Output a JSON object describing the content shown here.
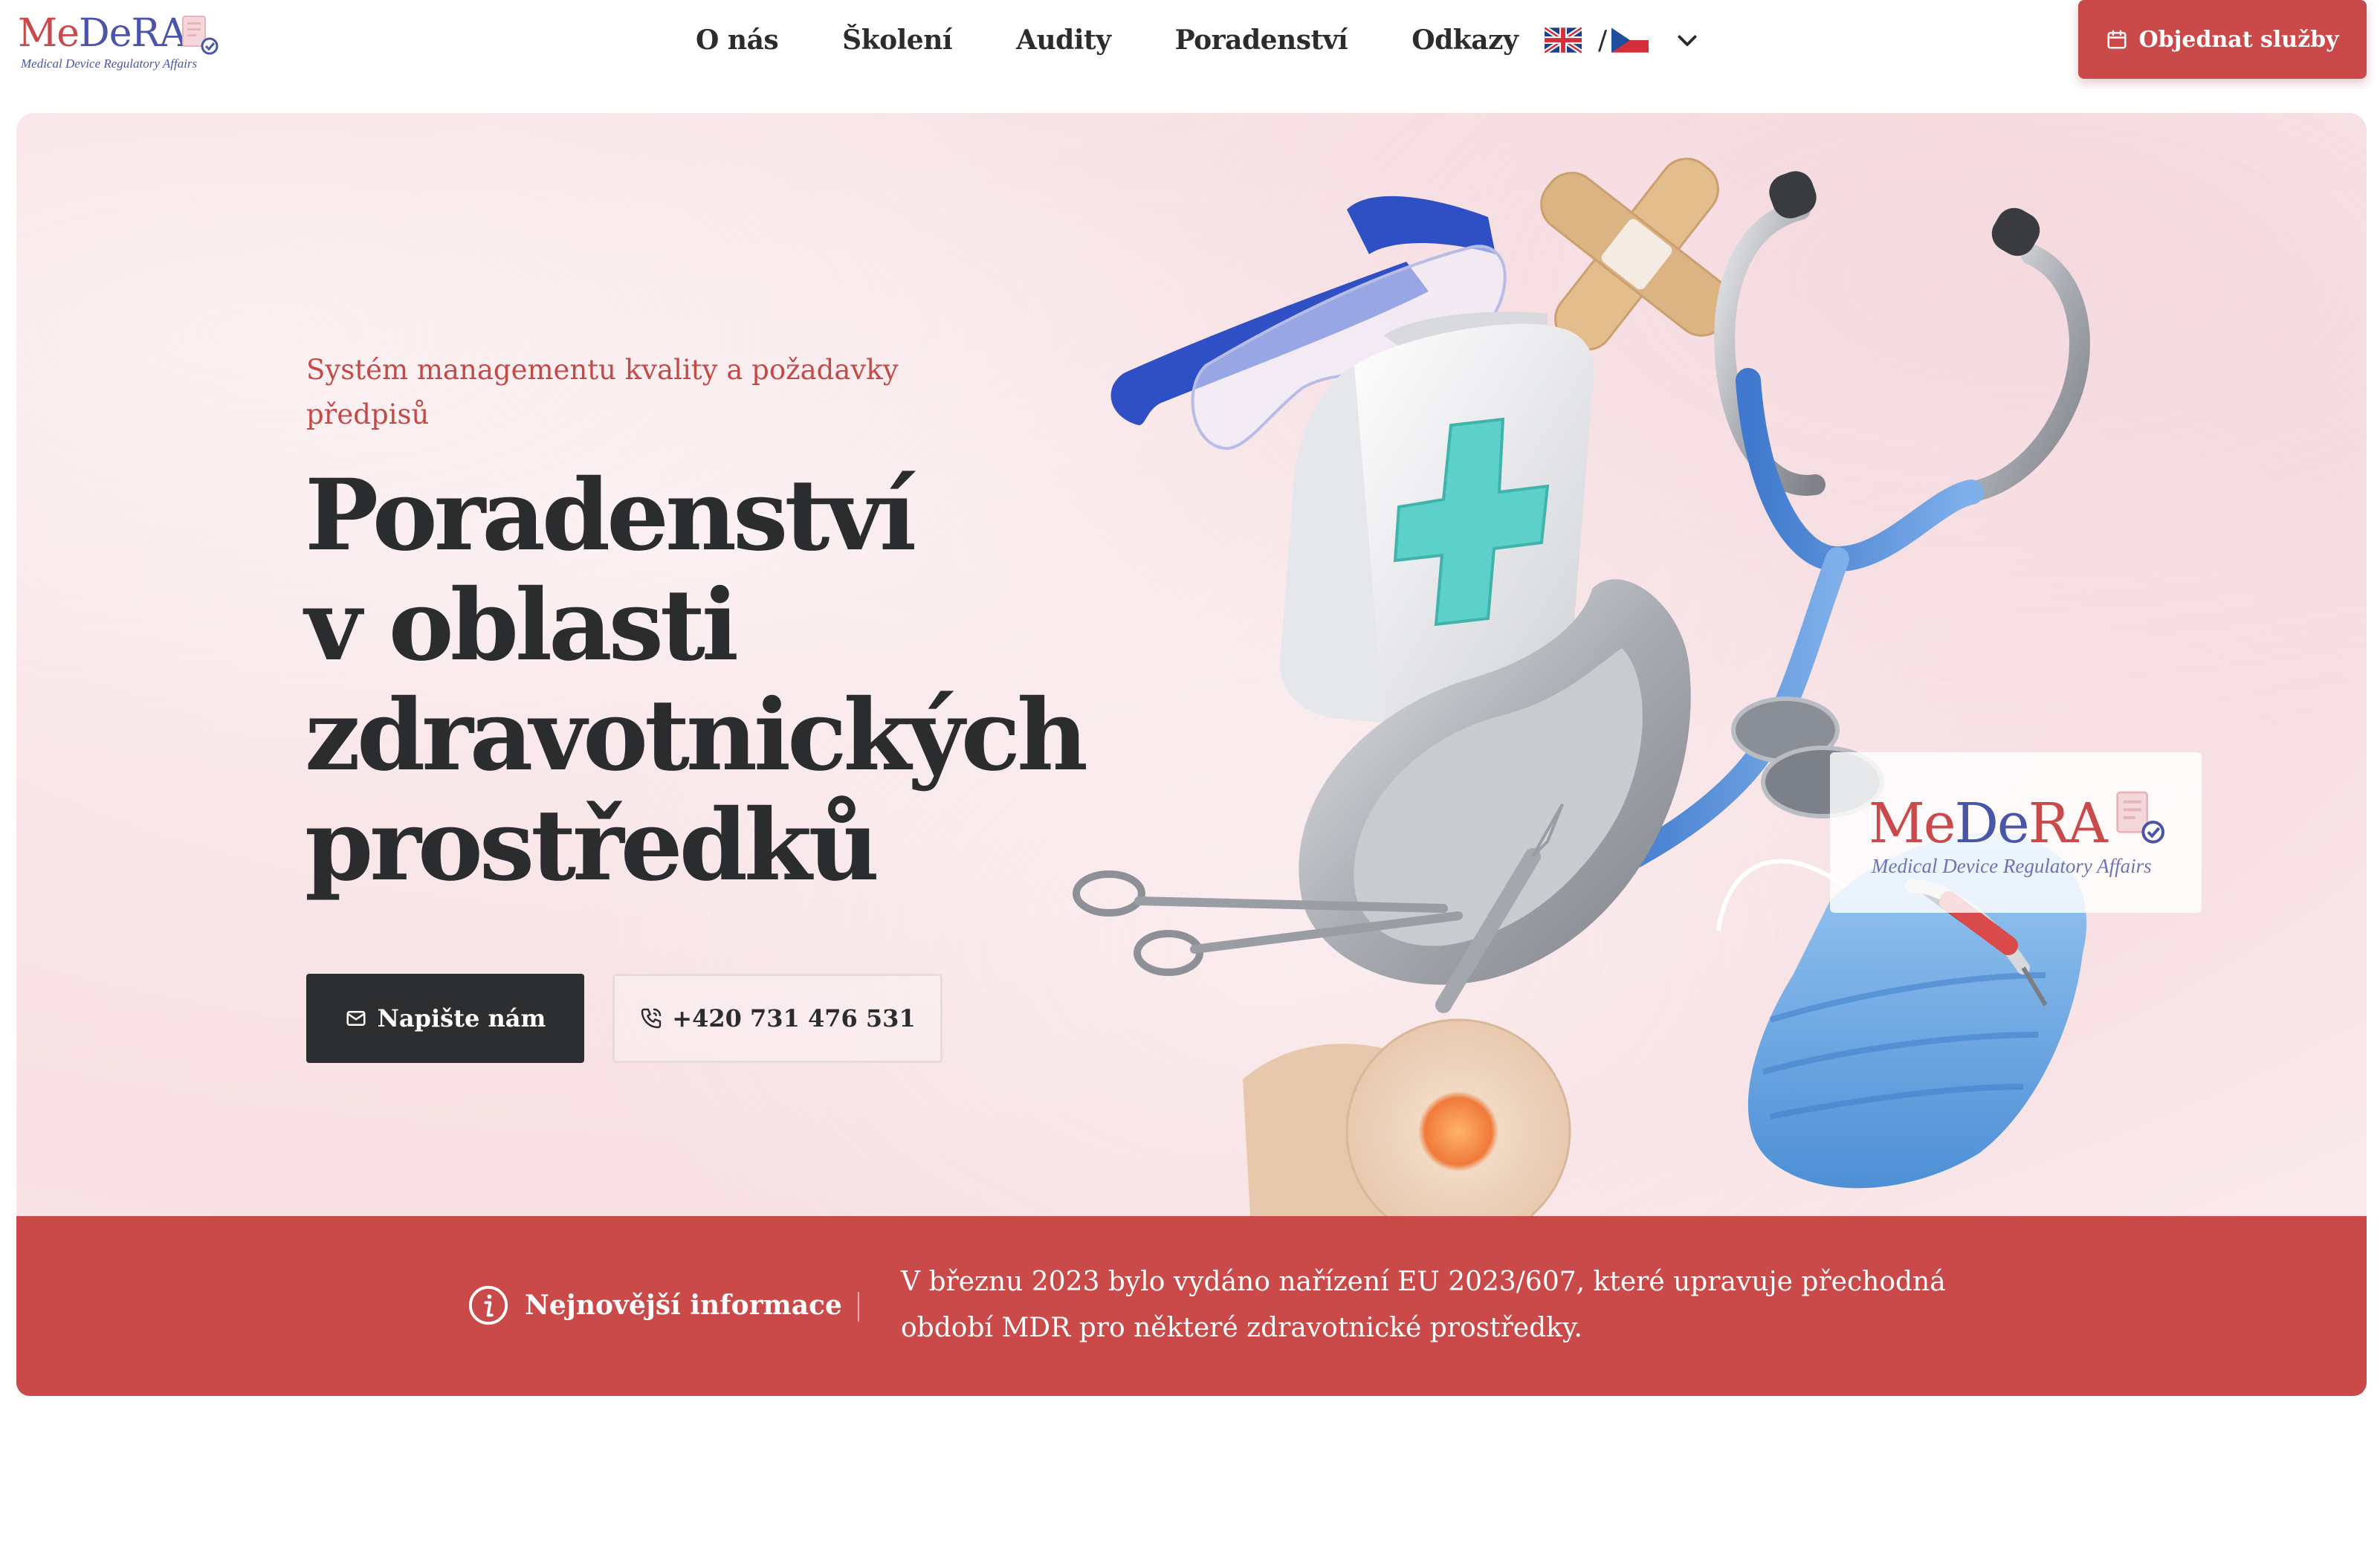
{
  "brand": {
    "logo_text_part1": "Me",
    "logo_text_part2": "De",
    "logo_text_part3": "RA",
    "logo_tagline": "Medical Device Regulatory Affairs",
    "red": "#c94a49",
    "blue": "#4a55a8"
  },
  "nav": {
    "items": [
      {
        "label": "O nás"
      },
      {
        "label": "Školení"
      },
      {
        "label": "Audity"
      },
      {
        "label": "Poradenství"
      },
      {
        "label": "Odkazy"
      }
    ],
    "language": {
      "separator": "/",
      "flags": [
        "uk-flag-icon",
        "cz-flag-icon"
      ],
      "toggle_icon": "chevron-down-icon"
    },
    "order_button": {
      "label": "Objednat služby",
      "icon": "calendar-icon"
    }
  },
  "hero": {
    "eyebrow": "Systém managementu kvality a požadavky předpisů",
    "title_lines": [
      "Poradenství",
      "v oblasti",
      "zdravotnických",
      "prostředků"
    ],
    "primary_button": {
      "label": "Napište nám",
      "icon": "mail-icon"
    },
    "secondary_button": {
      "label": "+420 731 476 531",
      "icon": "phone-icon"
    },
    "badge": {
      "text_part1": "Me",
      "text_part2": "De",
      "text_part3": "RA",
      "tagline": "Medical Device Regulatory Affairs"
    }
  },
  "news": {
    "label": "Nejnovější informace",
    "icon": "info-icon",
    "text": "V březnu 2023 bylo vydáno nařízení EU 2023/607, které upravuje přechodná období MDR pro některé zdravotnické prostředky."
  }
}
